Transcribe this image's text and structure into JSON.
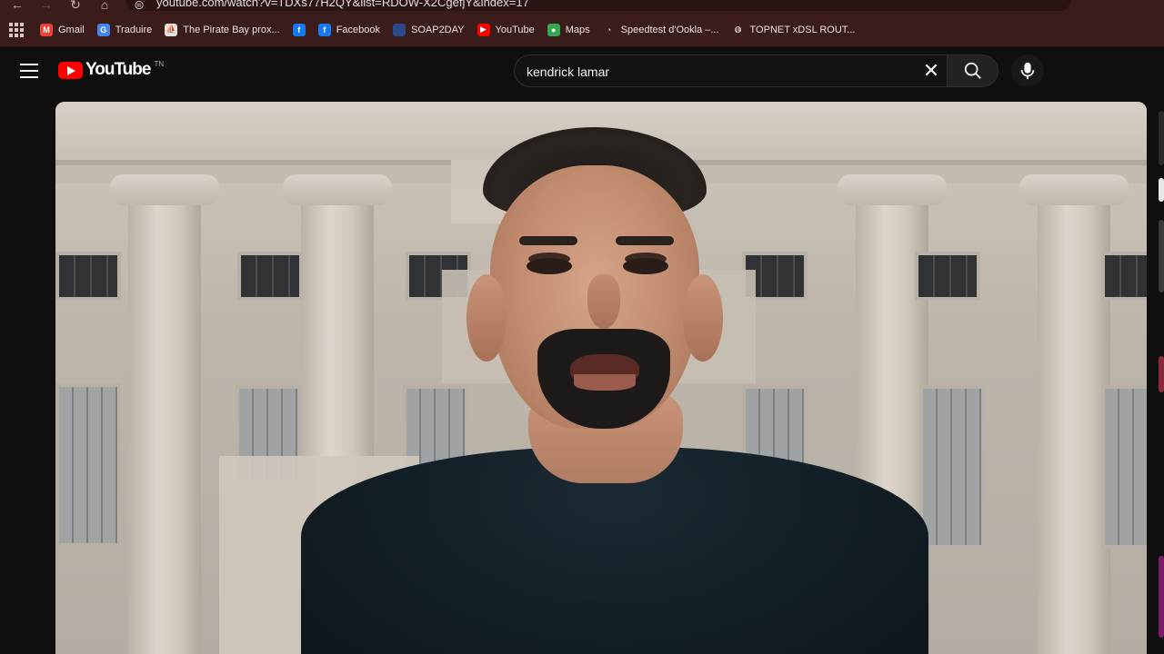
{
  "browser": {
    "url": "youtube.com/watch?v=TDXs77H2QY&list=RDOW-X2CgefjY&index=17",
    "bookmarks": [
      {
        "label": "Gmail",
        "icon": "gmail-icon",
        "color": "#ea4335",
        "glyph": "M"
      },
      {
        "label": "Traduire",
        "icon": "translate-icon",
        "color": "#4285f4",
        "glyph": "G"
      },
      {
        "label": "The Pirate Bay prox...",
        "icon": "pirate-icon",
        "color": "#e8e0d8",
        "glyph": "⛵"
      },
      {
        "label": "",
        "icon": "facebook-icon",
        "color": "#1877f2",
        "glyph": "f"
      },
      {
        "label": "Facebook",
        "icon": "facebook-icon",
        "color": "#1877f2",
        "glyph": "f"
      },
      {
        "label": "SOAP2DAY",
        "icon": "soap2day-icon",
        "color": "#2a4a8a",
        "glyph": ""
      },
      {
        "label": "YouTube",
        "icon": "youtube-icon",
        "color": "#ff0000",
        "glyph": "▶"
      },
      {
        "label": "Maps",
        "icon": "maps-icon",
        "color": "#34a853",
        "glyph": "●"
      },
      {
        "label": "Speedtest d'Ookla –...",
        "icon": "speedtest-icon",
        "color": "#3a1d1b",
        "glyph": "◔"
      },
      {
        "label": "TOPNET xDSL ROUT...",
        "icon": "globe-icon",
        "color": "#3a1d1b",
        "glyph": "◍"
      }
    ]
  },
  "masthead": {
    "logo_text": "YouTube",
    "country_code": "TN",
    "search_value": "kendrick lamar",
    "search_placeholder": "Search"
  },
  "colors": {
    "brand_red": "#ff0000",
    "background": "#0f0f0f",
    "chrome": "#3a1d1b"
  }
}
